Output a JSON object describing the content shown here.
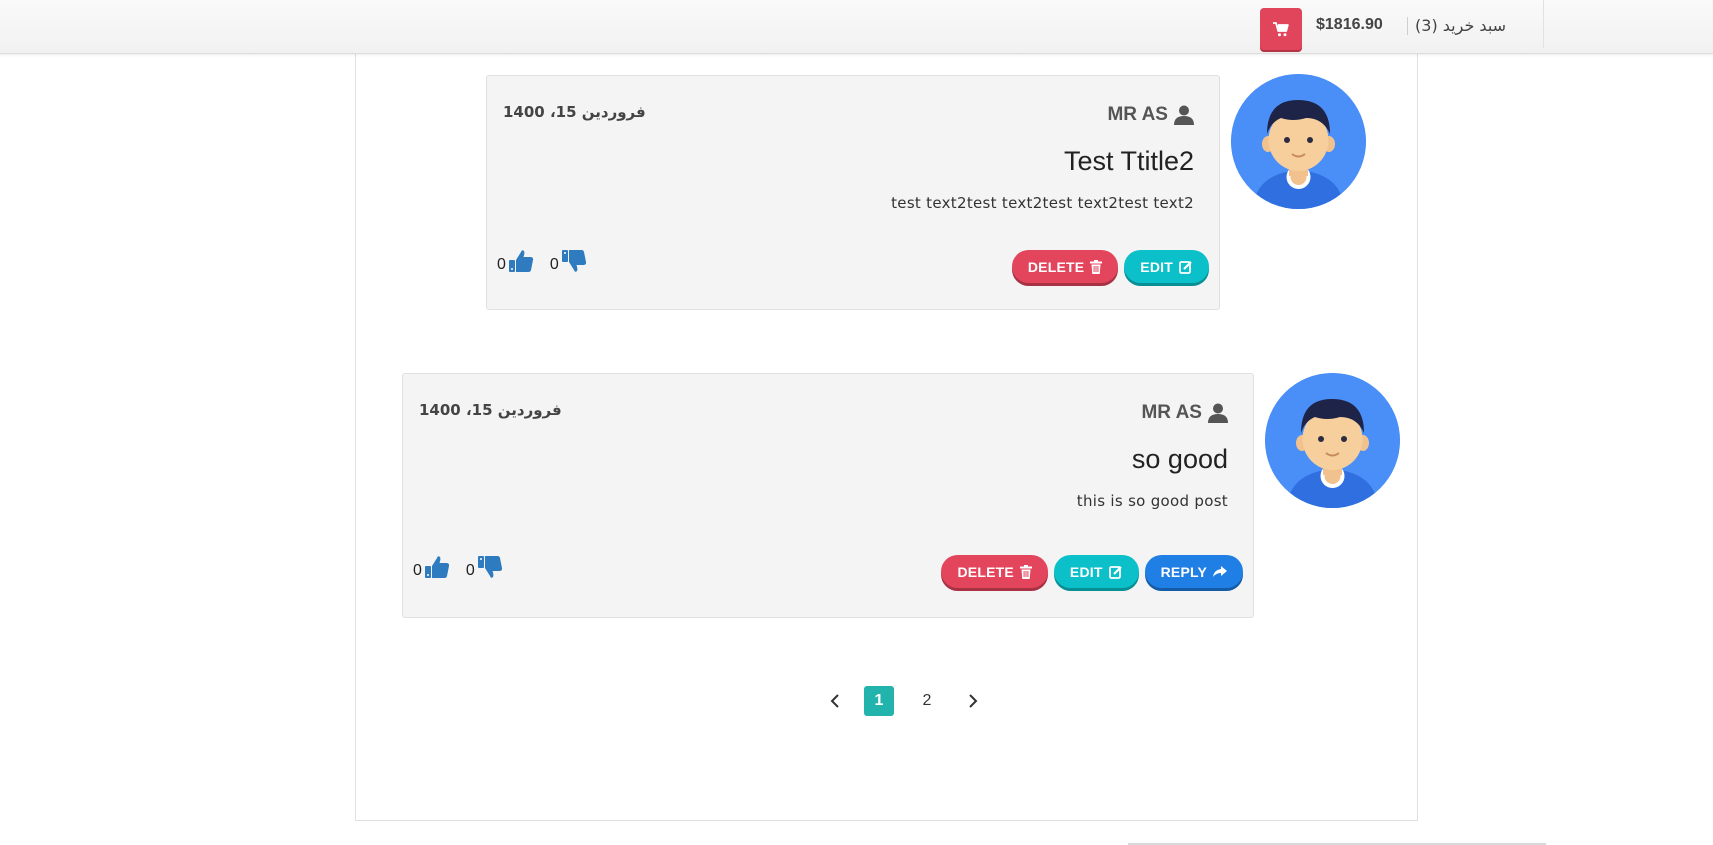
{
  "header": {
    "cart_label": "سبد خرید (3)",
    "cart_total": "$1816.90",
    "cart_icon": "shopping-cart-icon"
  },
  "comments": [
    {
      "author": "MR AS",
      "date": "فروردین 15، 1400",
      "title": "Test Ttitle2",
      "text": "test text2test text2test text2test text2",
      "likes": "0",
      "dislikes": "0",
      "buttons": {
        "delete": "DELETE",
        "edit": "EDIT"
      }
    },
    {
      "author": "MR AS",
      "date": "فروردین 15، 1400",
      "title": "so good",
      "text": "this is so good post",
      "likes": "0",
      "dislikes": "0",
      "buttons": {
        "delete": "DELETE",
        "edit": "EDIT",
        "reply": "REPLY"
      }
    }
  ],
  "pagination": {
    "prev": "‹",
    "pages": [
      "1",
      "2"
    ],
    "active": "1",
    "next": "›"
  },
  "colors": {
    "delete": "#e3455d",
    "edit": "#0cc0c9",
    "reply": "#1f7fe5",
    "cart": "#e0455c",
    "pagination_active": "#23b3ad",
    "avatar_bg": "#4a8ef7"
  }
}
